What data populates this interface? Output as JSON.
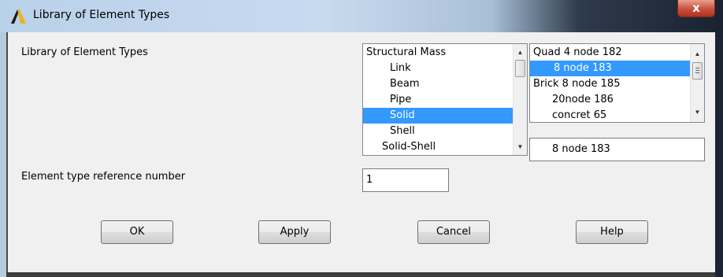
{
  "window": {
    "title": "Library of Element Types",
    "close_glyph": "x",
    "icon": "ansys-logo-icon"
  },
  "dialog": {
    "library_label": "Library of Element Types",
    "ref_label": "Element type reference number",
    "ref_value": "1"
  },
  "category_list": {
    "items": [
      "Structural Mass",
      "Link",
      "Beam",
      "Pipe",
      "Solid",
      "Shell",
      "Solid-Shell"
    ],
    "selected_index": 4
  },
  "element_list": {
    "items": [
      "Quad  4 node 182",
      "8 node 183",
      "Brick 8 node 185",
      "20node 186",
      "concret 65"
    ],
    "selected_index": 1
  },
  "selection_display": "8 node 183",
  "buttons": {
    "ok": "OK",
    "apply": "Apply",
    "cancel": "Cancel",
    "help": "Help"
  },
  "colors": {
    "selection": "#3399ff",
    "dialog_bg": "#f0f0f0"
  }
}
